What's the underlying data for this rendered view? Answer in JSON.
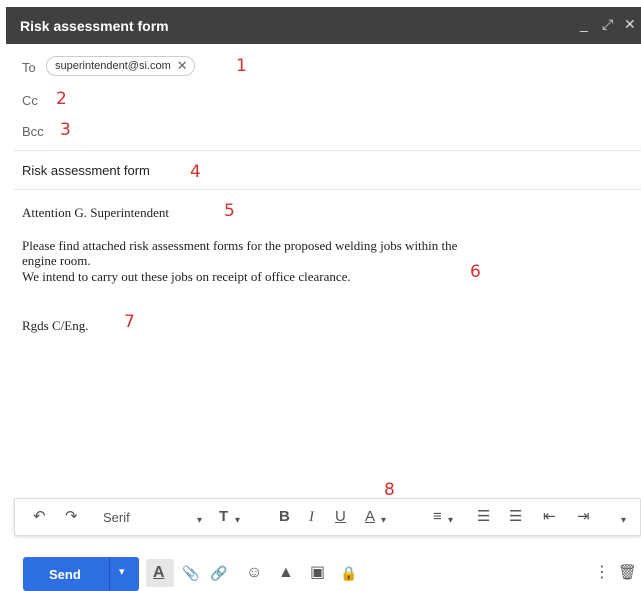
{
  "window": {
    "title": "Risk assessment form",
    "controls": {
      "minimize": "_",
      "popout": "⤢",
      "close": "✕"
    }
  },
  "recipients": {
    "to_label": "To",
    "to_chip": "superintendent@si.com",
    "chip_remove": "✕",
    "cc_label": "Cc",
    "bcc_label": "Bcc"
  },
  "subject": "Risk assessment form",
  "body": {
    "greeting": "Attention G. Superintendent",
    "line1": "Please find attached risk assessment forms for the proposed welding jobs within the",
    "line2": "engine room.",
    "line3": "We intend to carry out these jobs on receipt of office clearance.",
    "signoff": "Rgds C/Eng."
  },
  "annotations": [
    "1",
    "2",
    "3",
    "4",
    "5",
    "6",
    "7",
    "8"
  ],
  "toolbar": {
    "undo": "↶",
    "redo": "↷",
    "font": "Serif",
    "font_caret": "▾",
    "size": "T",
    "size_caret": "▾",
    "bold": "B",
    "italic": "I",
    "underline": "U",
    "text_color": "A",
    "color_caret": "▾",
    "align": "≡",
    "align_caret": "▾",
    "numbered": "☰",
    "bulleted": "☰",
    "indent_less": "⇤",
    "indent_more": "⇥",
    "more": "▾"
  },
  "bottom": {
    "send": "Send",
    "send_caret": "▾",
    "formatting": "A",
    "attach": "📎",
    "link": "🔗",
    "emoji": "☺",
    "drive": "▲",
    "photo": "▣",
    "confidential": "🔒",
    "more_options": "⋮",
    "discard": "🗑"
  },
  "colors": {
    "titlebar": "#404040",
    "send_button": "#2d6fe0",
    "annotation": "#d0312d"
  }
}
